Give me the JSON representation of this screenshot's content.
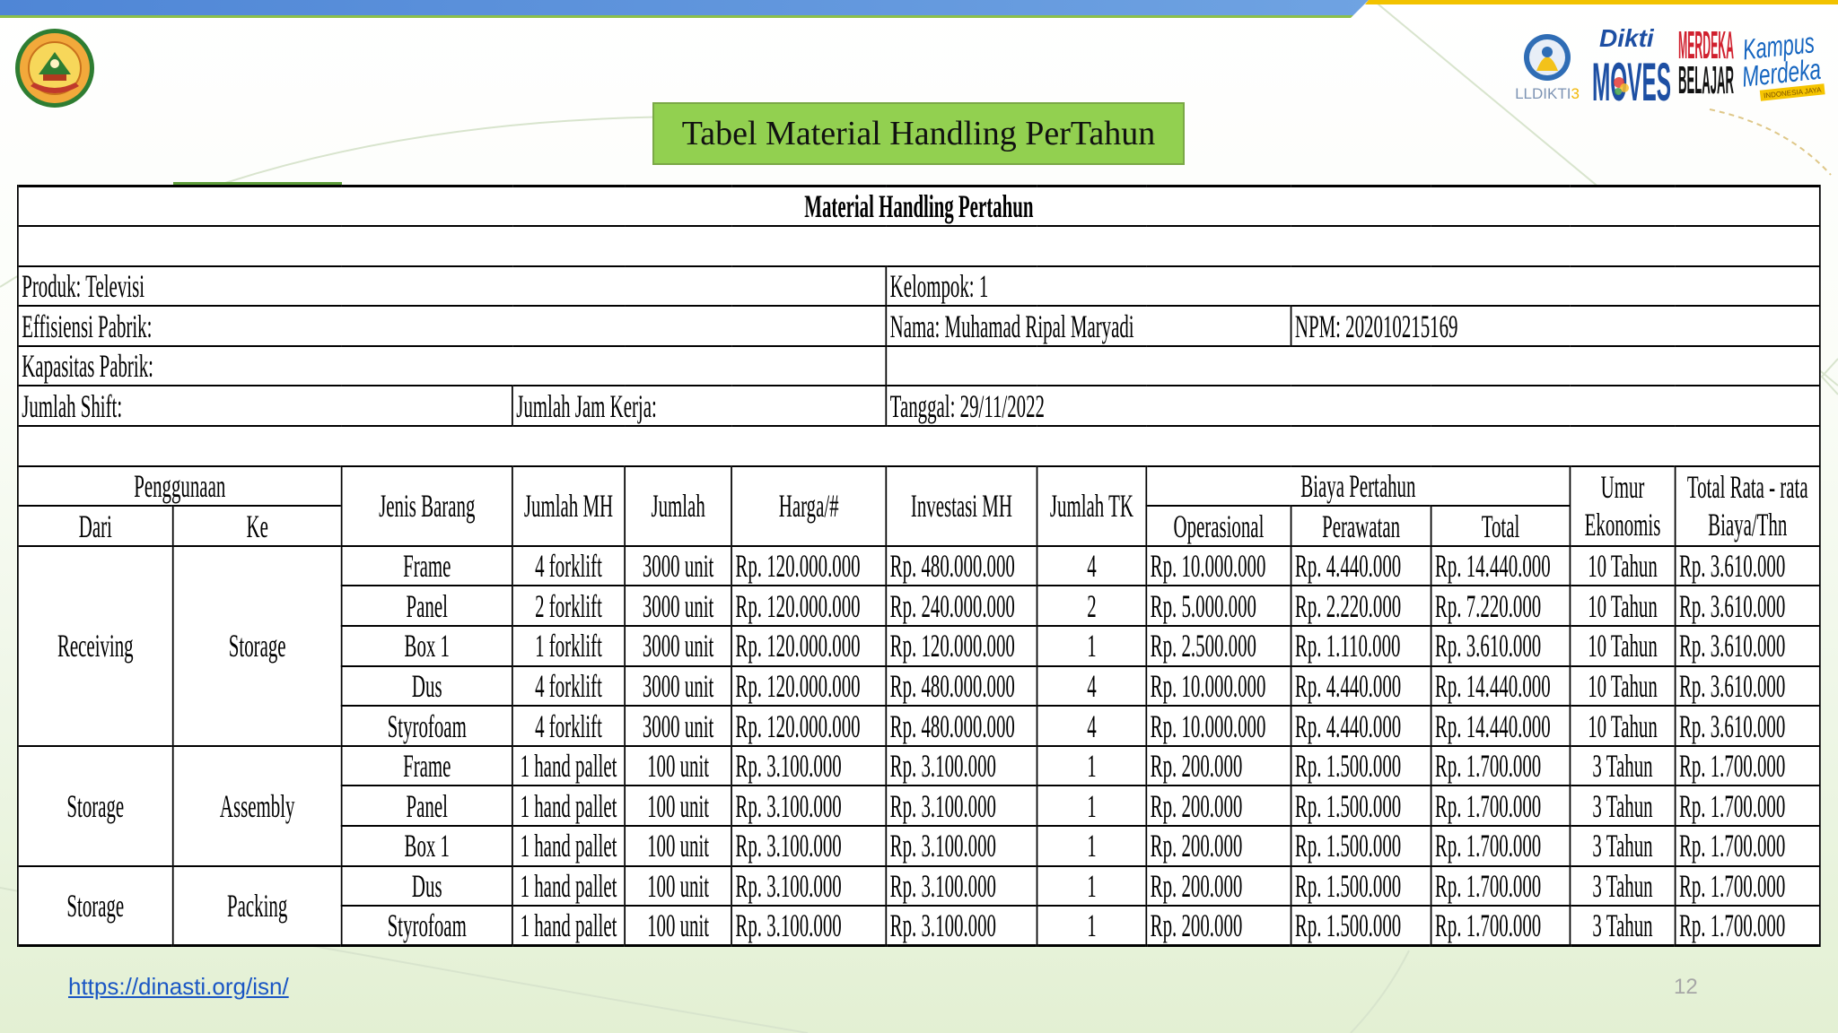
{
  "slide": {
    "title": "Tabel Material Handling PerTahun",
    "footer_link": "https://dinasti.org/isn/",
    "page_number": "12"
  },
  "colors": {
    "title_box": "#92d050",
    "top_stripe": "#5b8dd9",
    "top_accent": "#f2c200",
    "link": "#1a56c4",
    "page_number": "#a6a6a6"
  },
  "logos": {
    "left": {
      "icon": "university-emblem-icon"
    },
    "lldikti": {
      "icon": "lldikti-logo",
      "text": "LLDIKTI",
      "number": "3"
    },
    "dikti_moves": {
      "icon": "dikti-moves-logo",
      "top": "Dikti",
      "bottom": "MOVES"
    },
    "merdeka_belajar": {
      "icon": "merdeka-belajar-logo",
      "line1": "MERDEKA",
      "line2": "BELAJAR"
    },
    "kampus_merdeka": {
      "icon": "kampus-merdeka-logo",
      "line1": "Kampus",
      "line2": "Merdeka",
      "tagline": "INDONESIA JAYA"
    }
  },
  "table": {
    "title": "Material Handling Pertahun",
    "info": {
      "produk": "Produk: Televisi",
      "kelompok": "Kelompok: 1",
      "effisiensi": "Effisiensi Pabrik:",
      "nama": "Nama: Muhamad Ripal Maryadi",
      "npm": "NPM: 202010215169",
      "kapasitas": "Kapasitas Pabrik:",
      "shift": "Jumlah Shift:",
      "jam_kerja": "Jumlah Jam Kerja:",
      "tanggal": "Tanggal: 29/11/2022"
    },
    "headers": {
      "penggunaan": "Penggunaan",
      "dari": "Dari",
      "ke": "Ke",
      "jenis_barang": "Jenis Barang",
      "jumlah_mh": "Jumlah MH",
      "jumlah": "Jumlah",
      "harga": "Harga/#",
      "investasi_mh": "Investasi MH",
      "jumlah_tk": "Jumlah TK",
      "biaya_pertahun": "Biaya Pertahun",
      "operasional": "Operasional",
      "perawatan": "Perawatan",
      "total": "Total",
      "umur_line1": "Umur",
      "umur_line2": "Ekonomis",
      "rata_line1": "Total Rata - rata",
      "rata_line2": "Biaya/Thn"
    },
    "groups": [
      {
        "dari": "Receiving",
        "ke": "Storage",
        "rows": [
          {
            "jenis": "Frame",
            "jumlah_mh": "4 forklift",
            "jumlah": "3000 unit",
            "harga": "Rp. 120.000.000",
            "investasi": "Rp. 480.000.000",
            "jumlah_tk": "4",
            "operasional": "Rp. 10.000.000",
            "perawatan": "Rp. 4.440.000",
            "total": "Rp. 14.440.000",
            "umur": "10 Tahun",
            "rata_rata": "Rp. 3.610.000"
          },
          {
            "jenis": "Panel",
            "jumlah_mh": "2 forklift",
            "jumlah": "3000 unit",
            "harga": "Rp. 120.000.000",
            "investasi": "Rp. 240.000.000",
            "jumlah_tk": "2",
            "operasional": "Rp. 5.000.000",
            "perawatan": "Rp. 2.220.000",
            "total": "Rp. 7.220.000",
            "umur": "10 Tahun",
            "rata_rata": "Rp. 3.610.000"
          },
          {
            "jenis": "Box 1",
            "jumlah_mh": "1 forklift",
            "jumlah": "3000 unit",
            "harga": "Rp. 120.000.000",
            "investasi": "Rp. 120.000.000",
            "jumlah_tk": "1",
            "operasional": "Rp. 2.500.000",
            "perawatan": "Rp. 1.110.000",
            "total": "Rp. 3.610.000",
            "umur": "10 Tahun",
            "rata_rata": "Rp. 3.610.000"
          },
          {
            "jenis": "Dus",
            "jumlah_mh": "4 forklift",
            "jumlah": "3000 unit",
            "harga": "Rp. 120.000.000",
            "investasi": "Rp. 480.000.000",
            "jumlah_tk": "4",
            "operasional": "Rp. 10.000.000",
            "perawatan": "Rp. 4.440.000",
            "total": "Rp. 14.440.000",
            "umur": "10 Tahun",
            "rata_rata": "Rp. 3.610.000"
          },
          {
            "jenis": "Styrofoam",
            "jumlah_mh": "4 forklift",
            "jumlah": "3000 unit",
            "harga": "Rp. 120.000.000",
            "investasi": "Rp. 480.000.000",
            "jumlah_tk": "4",
            "operasional": "Rp. 10.000.000",
            "perawatan": "Rp. 4.440.000",
            "total": "Rp. 14.440.000",
            "umur": "10 Tahun",
            "rata_rata": "Rp. 3.610.000"
          }
        ]
      },
      {
        "dari": "Storage",
        "ke": "Assembly",
        "rows": [
          {
            "jenis": "Frame",
            "jumlah_mh": "1 hand pallet",
            "jumlah": "100 unit",
            "harga": "Rp. 3.100.000",
            "investasi": "Rp. 3.100.000",
            "jumlah_tk": "1",
            "operasional": "Rp. 200.000",
            "perawatan": "Rp. 1.500.000",
            "total": "Rp. 1.700.000",
            "umur": "3 Tahun",
            "rata_rata": "Rp. 1.700.000"
          },
          {
            "jenis": "Panel",
            "jumlah_mh": "1 hand pallet",
            "jumlah": "100 unit",
            "harga": "Rp. 3.100.000",
            "investasi": "Rp. 3.100.000",
            "jumlah_tk": "1",
            "operasional": "Rp. 200.000",
            "perawatan": "Rp. 1.500.000",
            "total": "Rp. 1.700.000",
            "umur": "3 Tahun",
            "rata_rata": "Rp. 1.700.000"
          },
          {
            "jenis": "Box 1",
            "jumlah_mh": "1 hand pallet",
            "jumlah": "100 unit",
            "harga": "Rp. 3.100.000",
            "investasi": "Rp. 3.100.000",
            "jumlah_tk": "1",
            "operasional": "Rp. 200.000",
            "perawatan": "Rp. 1.500.000",
            "total": "Rp. 1.700.000",
            "umur": "3 Tahun",
            "rata_rata": "Rp. 1.700.000"
          }
        ]
      },
      {
        "dari": "Storage",
        "ke": "Packing",
        "rows": [
          {
            "jenis": "Dus",
            "jumlah_mh": "1 hand pallet",
            "jumlah": "100 unit",
            "harga": "Rp. 3.100.000",
            "investasi": "Rp. 3.100.000",
            "jumlah_tk": "1",
            "operasional": "Rp. 200.000",
            "perawatan": "Rp. 1.500.000",
            "total": "Rp. 1.700.000",
            "umur": "3 Tahun",
            "rata_rata": "Rp. 1.700.000"
          },
          {
            "jenis": "Styrofoam",
            "jumlah_mh": "1 hand pallet",
            "jumlah": "100 unit",
            "harga": "Rp. 3.100.000",
            "investasi": "Rp. 3.100.000",
            "jumlah_tk": "1",
            "operasional": "Rp. 200.000",
            "perawatan": "Rp. 1.500.000",
            "total": "Rp. 1.700.000",
            "umur": "3 Tahun",
            "rata_rata": "Rp. 1.700.000"
          }
        ]
      }
    ]
  }
}
